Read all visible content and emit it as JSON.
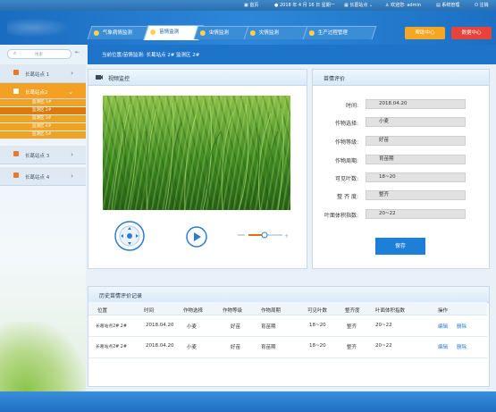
{
  "topbar": {
    "home": "首页",
    "date": "2018 年 4 月 16 日 星期一",
    "station": "长葛站点",
    "welcome": "欢迎您: admin",
    "sys_manage": "系统管理",
    "logout": "注销"
  },
  "nav": {
    "tabs": [
      {
        "label": "气象病情监测"
      },
      {
        "label": "苗情监测"
      },
      {
        "label": "虫情监测"
      },
      {
        "label": "灾情监测"
      },
      {
        "label": "生产过程管理"
      }
    ],
    "active_index": 1,
    "btn_help": "帮助中心",
    "btn_data": "数据中心",
    "btn_help_color": "#f5a623",
    "btn_data_color": "#e8433a"
  },
  "sidebar": {
    "search_placeholder": "搜索",
    "sites": [
      {
        "label": "长葛站点 1"
      },
      {
        "label": "长葛站点2"
      },
      {
        "label": "长葛站点 3"
      },
      {
        "label": "长葛站点 4"
      }
    ],
    "sub_items": [
      "监测区 1#",
      "监测区 2#",
      "监测区 3#",
      "监测区 4#",
      "监测区 5#"
    ],
    "selected_sub": 1,
    "accent": "#f3a124"
  },
  "breadcrumb": "当前位置/苗情监测: 长葛站点 2# 监测区 2#",
  "video": {
    "title": "视频监控"
  },
  "evaluation": {
    "title": "苗情评价",
    "fields": [
      {
        "label": "时间:",
        "value": "2018.04.20"
      },
      {
        "label": "作物选择:",
        "value": "小麦"
      },
      {
        "label": "作物等级:",
        "value": "好苗"
      },
      {
        "label": "作物周期:",
        "value": "育苗期"
      },
      {
        "label": "可见叶数:",
        "value": "18~20"
      },
      {
        "label": "整 齐 度:",
        "value": "整齐"
      },
      {
        "label": "叶面体积指数:",
        "value": "20~22"
      }
    ],
    "save_label": "保存",
    "save_color": "#1e7fd8"
  },
  "history": {
    "title": "历史苗情评价记录",
    "columns": [
      "位置",
      "时间",
      "作物选择",
      "作物等级",
      "作物周期",
      "可见叶数",
      "整齐度",
      "叶面体积指数",
      "操作"
    ],
    "rows": [
      {
        "loc": "长葛站点2# 2#",
        "time": "2018.04.20",
        "crop": "小麦",
        "grade": "好苗",
        "period": "育苗期",
        "leaves": "18~20",
        "even": "整齐",
        "lai": "20~22",
        "edit": "编辑",
        "del": "删除"
      },
      {
        "loc": "长葛站点2# 2#",
        "time": "2018.04.20",
        "crop": "小麦",
        "grade": "好苗",
        "period": "育苗期",
        "leaves": "18~20",
        "even": "整齐",
        "lai": "20~22",
        "edit": "编辑",
        "del": "删除"
      }
    ]
  }
}
